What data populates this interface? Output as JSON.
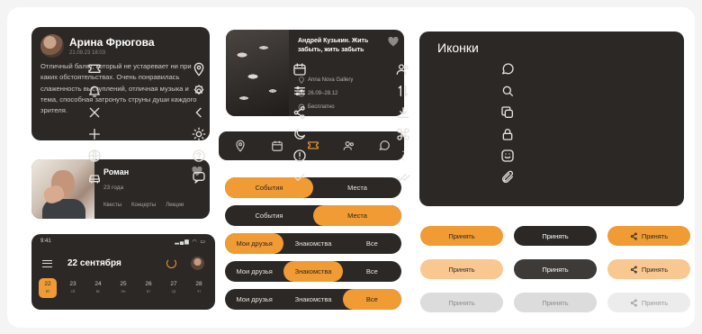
{
  "review": {
    "name": "Арина Фрюгова",
    "date": "21.09.23 18:03",
    "text": "Отличный балет, который не устаревает ни при каких обстоятельствах. Очень понравилась слаженность выступлений, отличная музыка и тема, способная затронуть струны души каждого зрителя."
  },
  "person": {
    "name": "Роман",
    "age": "23 года",
    "tags": [
      "Квесты",
      "Концерты",
      "Лекции"
    ]
  },
  "calendar": {
    "time": "9:41",
    "signal": "▂▄▆ ◠ ▭",
    "title": "22 сентября",
    "days": [
      {
        "num": "22",
        "sub": "пт",
        "active": true
      },
      {
        "num": "23",
        "sub": "сб"
      },
      {
        "num": "24",
        "sub": "вс"
      },
      {
        "num": "25",
        "sub": "пн"
      },
      {
        "num": "26",
        "sub": "вт"
      },
      {
        "num": "27",
        "sub": "ср"
      },
      {
        "num": "28",
        "sub": "чт"
      }
    ]
  },
  "event": {
    "title": "Андрей Кузькин. Жить забыть, жить забыть",
    "place": "Anna Nova Gallery",
    "dates": "26.09–28.12",
    "price": "Бесплатно"
  },
  "strip_icons": [
    "location-icon",
    "calendar-icon",
    "ticket-icon",
    "people-icon",
    "chat-icon"
  ],
  "segments": [
    {
      "options": [
        "События",
        "Места"
      ],
      "active": 0
    },
    {
      "options": [
        "События",
        "Места"
      ],
      "active": 1
    },
    {
      "options": [
        "Мои друзья",
        "Знакомства",
        "Все"
      ],
      "active": 0
    },
    {
      "options": [
        "Мои друзья",
        "Знакомства",
        "Все"
      ],
      "active": 1
    },
    {
      "options": [
        "Мои друзья",
        "Знакомства",
        "Все"
      ],
      "active": 2
    }
  ],
  "icons_panel": {
    "title": "Иконки",
    "icons": [
      "ticket-icon",
      "location-icon",
      "calendar-icon",
      "people-icon",
      "chat-icon",
      "bell-icon",
      "settings-icon",
      "sliders-icon",
      "sort-icon",
      "search-icon",
      "close-icon",
      "chevron-left-icon",
      "share-icon",
      "download-icon",
      "copy-icon",
      "plus-icon",
      "sun-icon",
      "moon-icon",
      "grid-icon",
      "lock-icon",
      "globe-icon",
      "question-icon",
      "info-icon",
      "more-icon",
      "smile-icon",
      "car-icon",
      "message-icon",
      "check-icon",
      "double-check-icon",
      "clip-icon"
    ]
  },
  "buttons": {
    "label": "Принять",
    "colors": {
      "accent": "#f09b34",
      "dark": "#2b2826",
      "light": "#f9c890",
      "disabled": "#dcdcdc"
    }
  }
}
